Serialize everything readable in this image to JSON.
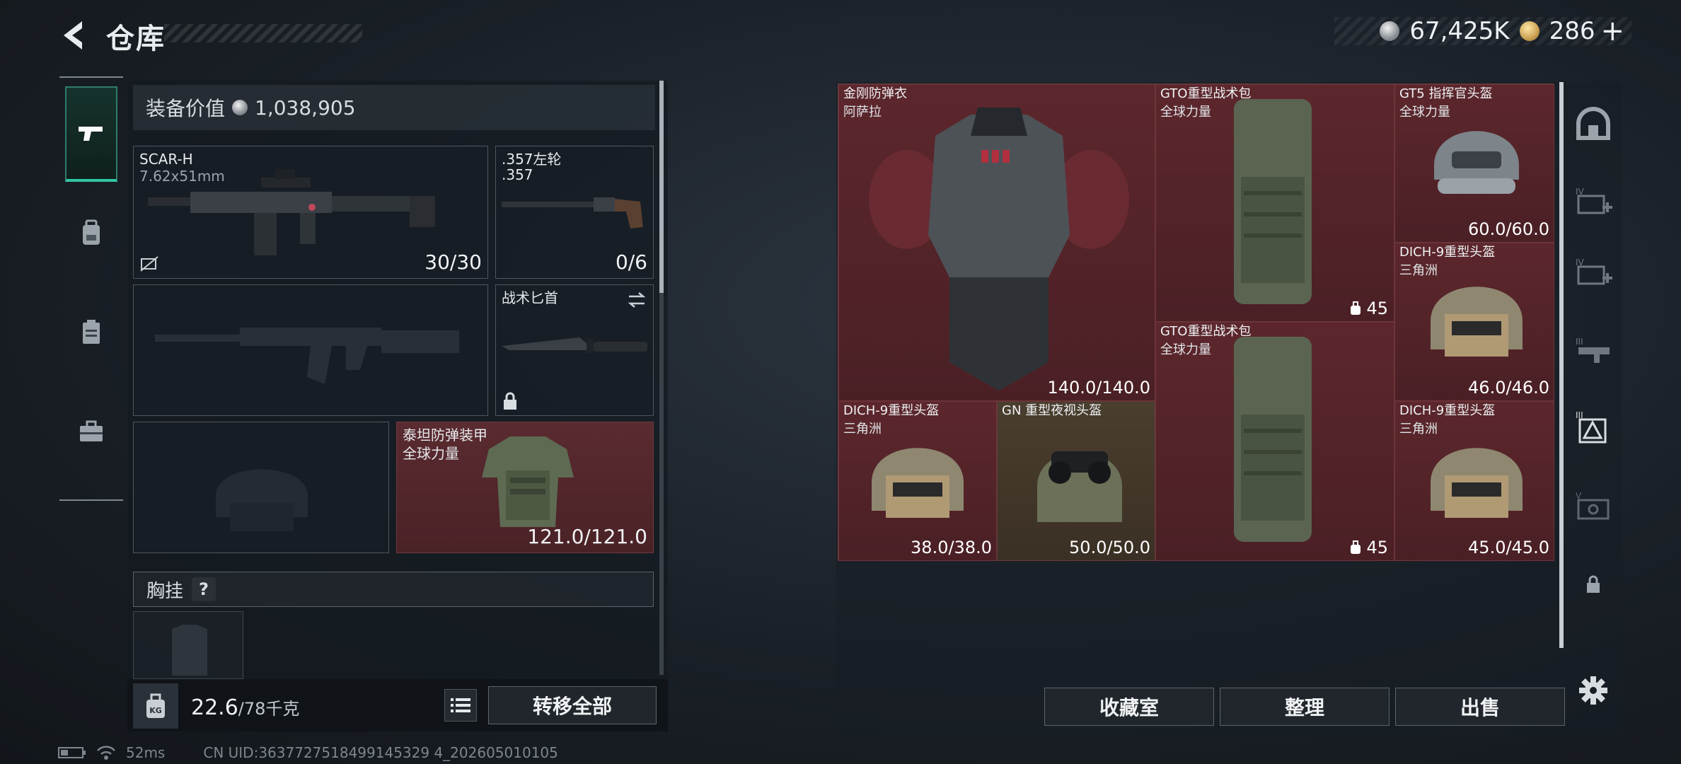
{
  "header": {
    "title": "仓库",
    "silver": "67,425K",
    "gold": "286",
    "gold_plus": "+"
  },
  "equipment": {
    "value_label": "装备价值",
    "value": "1,038,905",
    "primary": {
      "name": "SCAR-H",
      "caliber": "7.62x51mm",
      "ammo": "30/30"
    },
    "secondary": {
      "name": ".357左轮",
      "caliber": ".357",
      "ammo": "0/6"
    },
    "melee": {
      "name": "战术匕首"
    },
    "armor": {
      "name": "泰坦防弹装甲",
      "sub": "全球力量",
      "durability": "121.0/121.0"
    },
    "chest_rig_label": "胸挂",
    "chest_help": "?",
    "weight_current": "22.6",
    "weight_max": "/78千克",
    "transfer_all": "转移全部"
  },
  "storage": {
    "items": [
      {
        "name": "金刚防弹衣",
        "sub": "阿萨拉",
        "value": "140.0/140.0"
      },
      {
        "name": "GTO重型战术包",
        "sub": "全球力量",
        "value": "45"
      },
      {
        "name": "GT5 指挥官头盔",
        "sub": "全球力量",
        "value": "60.0/60.0"
      },
      {
        "name": "DICH-9重型头盔",
        "sub": "三角洲",
        "value": "46.0/46.0"
      },
      {
        "name": "GTO重型战术包",
        "sub": "全球力量",
        "value": "45"
      },
      {
        "name": "DICH-9重型头盔",
        "sub": "三角洲",
        "value": "38.0/38.0"
      },
      {
        "name": "GN 重型夜视头盔",
        "sub": "",
        "value": "50.0/50.0"
      },
      {
        "name": "DICH-9重型头盔",
        "sub": "三角洲",
        "value": "45.0/45.0"
      }
    ],
    "collection_btn": "收藏室",
    "sort_btn": "整理",
    "sell_btn": "出售"
  },
  "status_bar": {
    "ping": "52ms",
    "uid": "CN UID:3637727518499145329 4_202605010105"
  },
  "colors": {
    "accent": "#32c6a5",
    "item_red": "#5c272c",
    "item_brown": "#4a3e2e"
  }
}
